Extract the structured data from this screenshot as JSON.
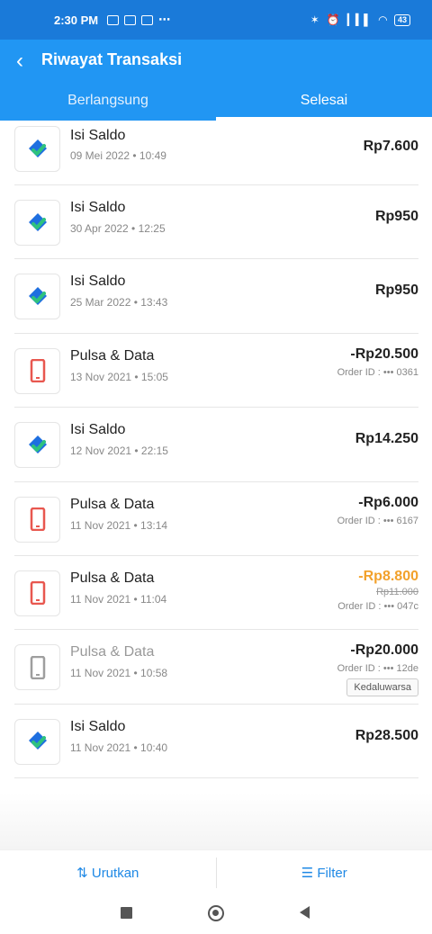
{
  "status": {
    "time": "2:30 PM",
    "dots": "⋯",
    "battery": "43"
  },
  "header": {
    "title": "Riwayat Transaksi"
  },
  "tabs": [
    {
      "label": "Berlangsung"
    },
    {
      "label": "Selesai"
    }
  ],
  "transactions": [
    {
      "type": "Isi Saldo",
      "date": "09 Mei 2022 • 10:49",
      "amount": "Rp7.600"
    },
    {
      "type": "Isi Saldo",
      "date": "30 Apr 2022 • 12:25",
      "amount": "Rp950"
    },
    {
      "type": "Isi Saldo",
      "date": "25 Mar 2022 • 13:43",
      "amount": "Rp950"
    },
    {
      "type": "Pulsa & Data",
      "date": "13 Nov 2021 • 15:05",
      "amount": "-Rp20.500",
      "order_id": "Order ID : ••• 0361"
    },
    {
      "type": "Isi Saldo",
      "date": "12 Nov 2021 • 22:15",
      "amount": "Rp14.250"
    },
    {
      "type": "Pulsa & Data",
      "date": "11 Nov 2021 • 13:14",
      "amount": "-Rp6.000",
      "order_id": "Order ID : ••• 6167"
    },
    {
      "type": "Pulsa & Data",
      "date": "11 Nov 2021 • 11:04",
      "amount": "-Rp8.800",
      "original_amount": "Rp11.000",
      "order_id": "Order ID : ••• 047c"
    },
    {
      "type": "Pulsa & Data",
      "date": "11 Nov 2021 • 10:58",
      "amount": "-Rp20.000",
      "order_id": "Order ID : ••• 12de",
      "badge": "Kedaluwarsa"
    },
    {
      "type": "Isi Saldo",
      "date": "11 Nov 2021 • 10:40",
      "amount": "Rp28.500"
    }
  ],
  "bottom": {
    "sort_label": "Urutkan",
    "filter_label": "Filter"
  },
  "colors": {
    "primary": "#2196f3",
    "statusbar": "#1a7ad9",
    "promo": "#f2a12b",
    "phone_icon": "#e8574f",
    "wallet_blue": "#1e6fe0",
    "wallet_green": "#2ec27e"
  }
}
